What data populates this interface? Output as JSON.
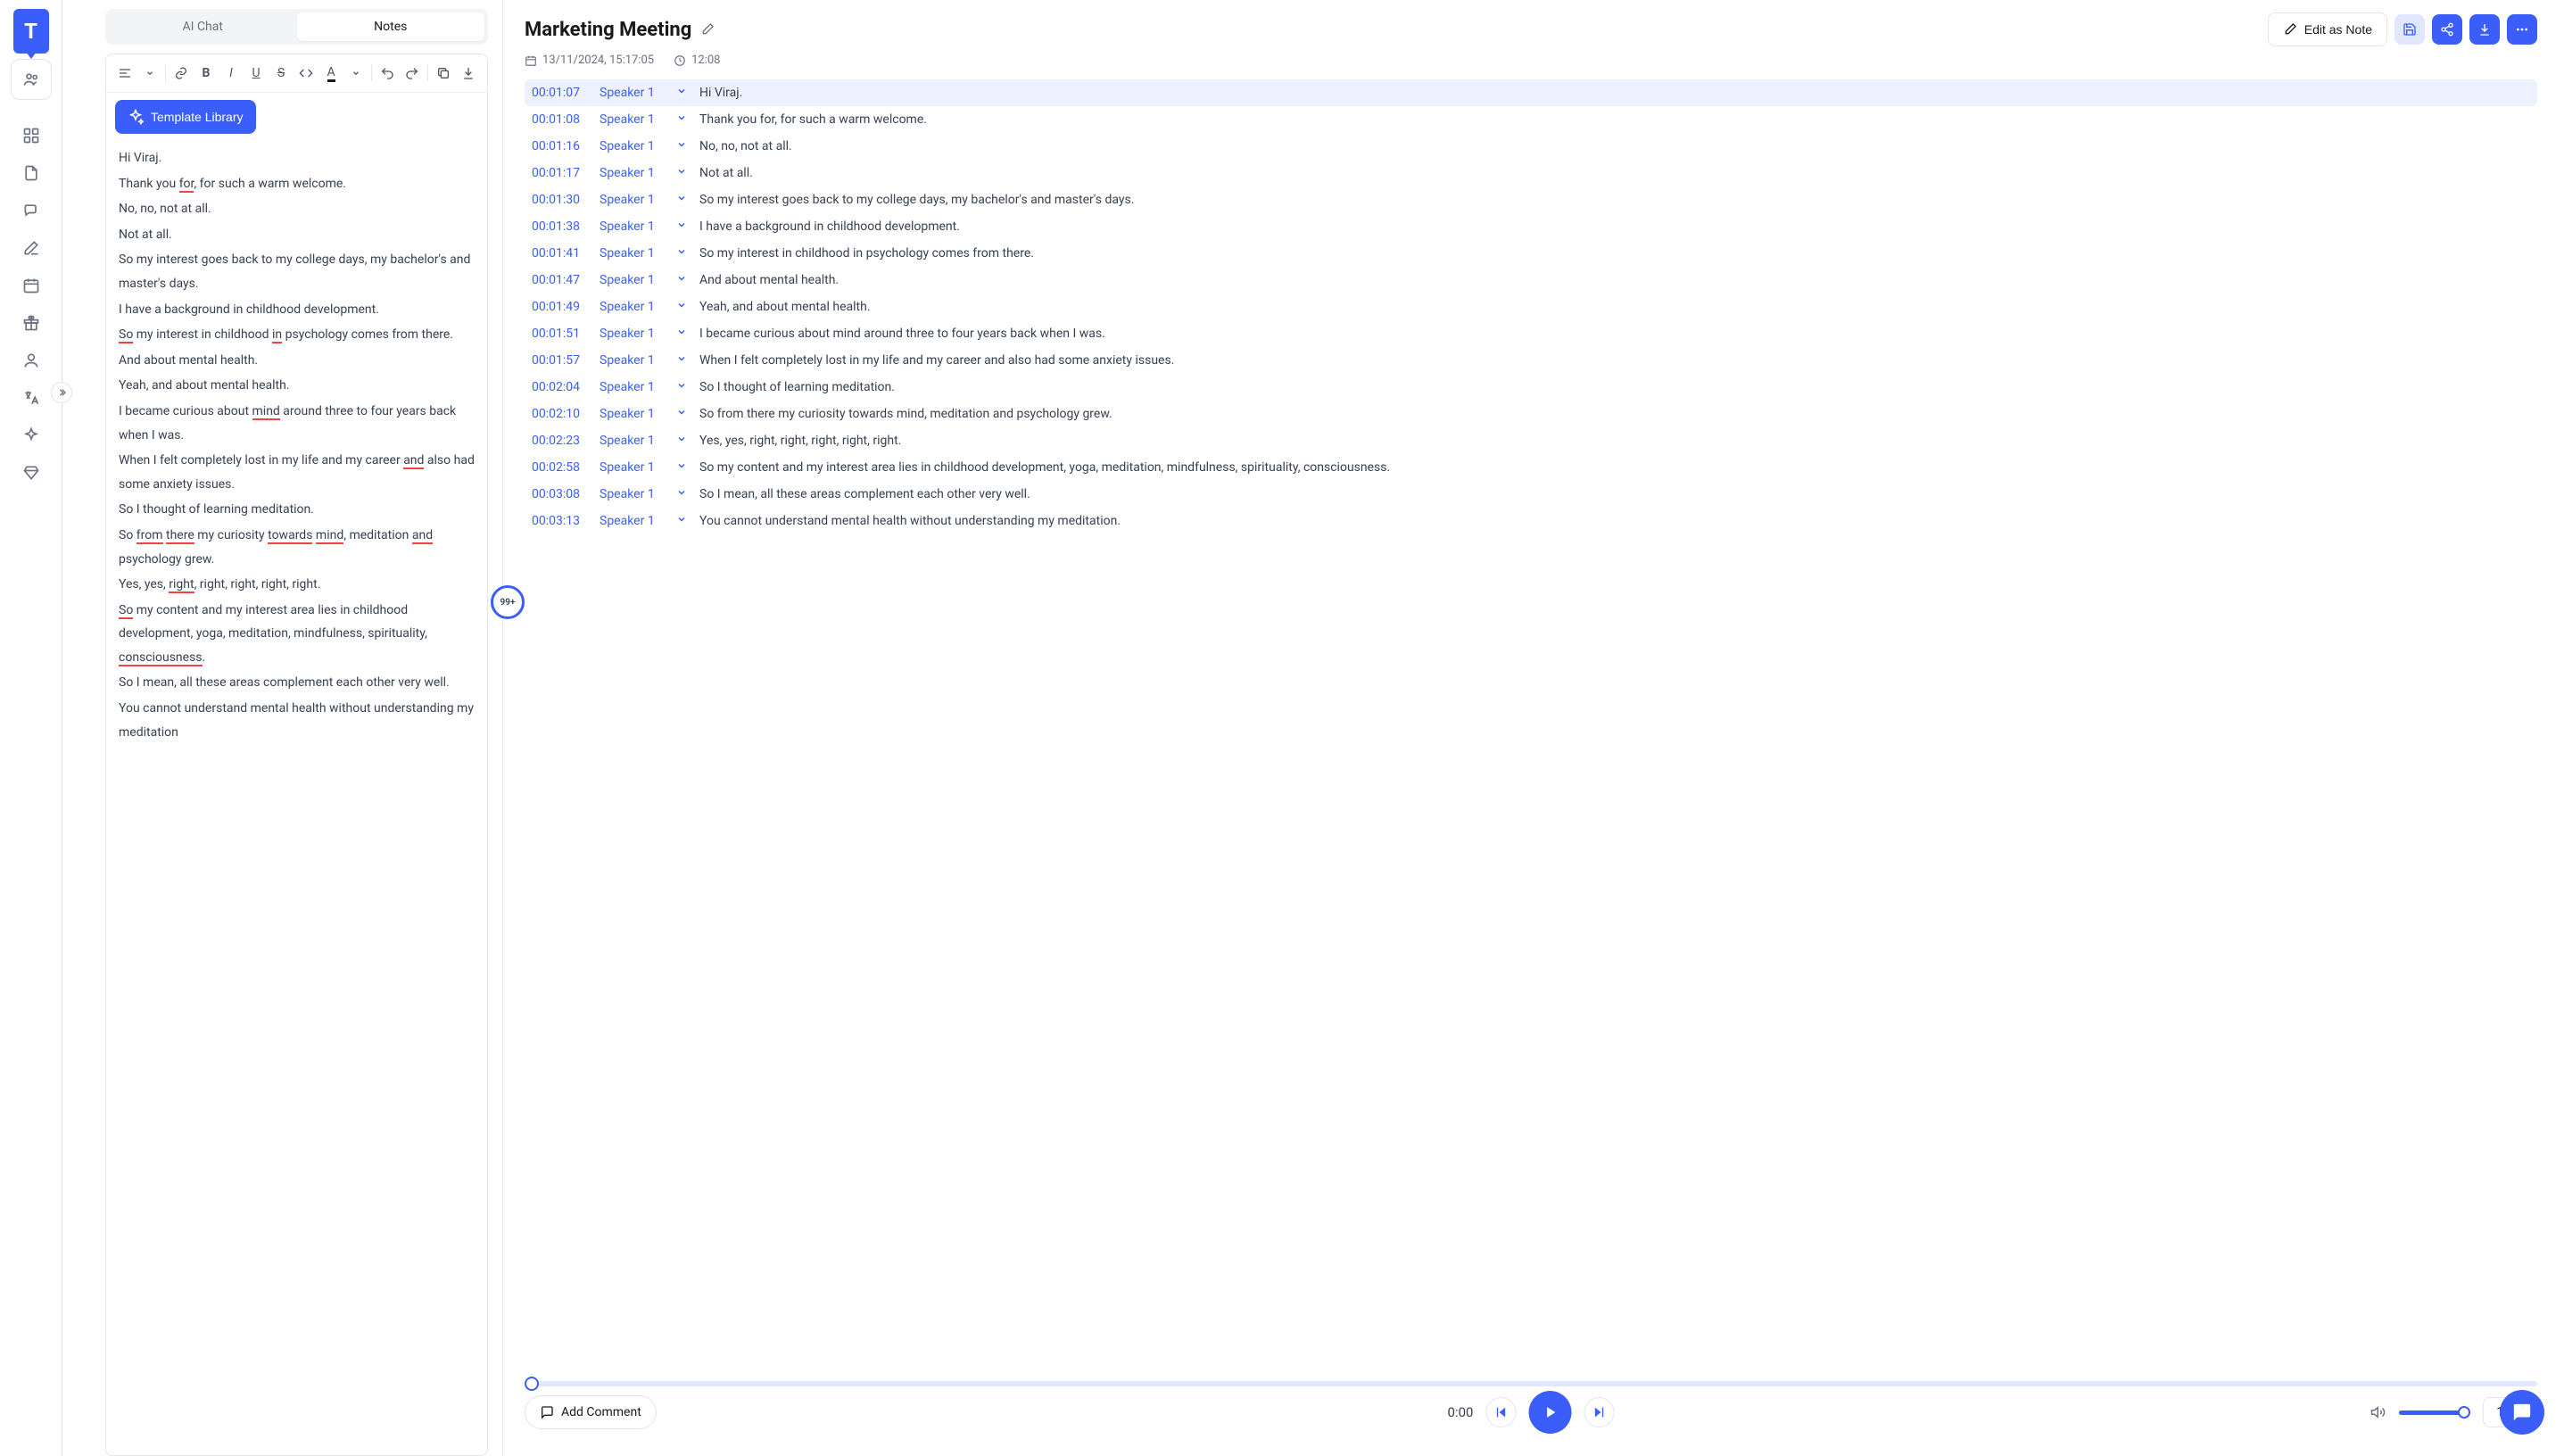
{
  "logo": "T",
  "tabs": {
    "chat": "AI Chat",
    "notes": "Notes"
  },
  "template_btn": "Template Library",
  "notes_lines": [
    "Hi Viraj.",
    "Thank you <u>for</u>, for such a warm welcome.",
    "No, no, not at all.",
    "Not at all.",
    "So my interest goes back to my college days, my bachelor's and master's days.",
    "I have a background in childhood development.",
    "<u>So</u> my interest in childhood <u>in</u> psychology comes from there.",
    "And about mental health.",
    "Yeah, and about mental health.",
    "I became curious about <u>mind</u> around three to four years back when I was.",
    "When I felt completely lost in my life and my career <u>and</u> also had some anxiety issues.",
    "So I thought of learning meditation.",
    "So <u>from</u> <u>there</u> my curiosity <u>towards</u> <u>mind</u>, meditation <u>and</u> psychology grew.",
    "Yes, yes, <u>right</u>, right, right, right, right.",
    "<u>So</u> my content and my interest area lies in childhood development, yoga, meditation, mindfulness, spirituality, <u>consciousness</u>.",
    "So I mean, all these areas complement each other very well.",
    "You cannot understand mental health without understanding my meditation"
  ],
  "doc_title": "Marketing Meeting",
  "edit_note": "Edit as Note",
  "meta": {
    "date": "13/11/2024, 15:17:05",
    "duration": "12:08"
  },
  "transcript": [
    {
      "time": "00:01:07",
      "speaker": "Speaker 1",
      "text": "Hi Viraj."
    },
    {
      "time": "00:01:08",
      "speaker": "Speaker 1",
      "text": "Thank you for, for such a warm welcome."
    },
    {
      "time": "00:01:16",
      "speaker": "Speaker 1",
      "text": "No, no, not at all."
    },
    {
      "time": "00:01:17",
      "speaker": "Speaker 1",
      "text": "Not at all."
    },
    {
      "time": "00:01:30",
      "speaker": "Speaker 1",
      "text": "So my interest goes back to my college days, my bachelor's and master's days."
    },
    {
      "time": "00:01:38",
      "speaker": "Speaker 1",
      "text": "I have a background in childhood development."
    },
    {
      "time": "00:01:41",
      "speaker": "Speaker 1",
      "text": "So my interest in childhood in psychology comes from there."
    },
    {
      "time": "00:01:47",
      "speaker": "Speaker 1",
      "text": "And about mental health."
    },
    {
      "time": "00:01:49",
      "speaker": "Speaker 1",
      "text": "Yeah, and about mental health."
    },
    {
      "time": "00:01:51",
      "speaker": "Speaker 1",
      "text": "I became curious about mind around three to four years back when I was."
    },
    {
      "time": "00:01:57",
      "speaker": "Speaker 1",
      "text": "When I felt completely lost in my life and my career and also had some anxiety issues."
    },
    {
      "time": "00:02:04",
      "speaker": "Speaker 1",
      "text": "So I thought of learning meditation."
    },
    {
      "time": "00:02:10",
      "speaker": "Speaker 1",
      "text": "So from there my curiosity towards mind, meditation and psychology grew."
    },
    {
      "time": "00:02:23",
      "speaker": "Speaker 1",
      "text": "Yes, yes, right, right, right, right, right."
    },
    {
      "time": "00:02:58",
      "speaker": "Speaker 1",
      "text": "So my content and my interest area lies in childhood development, yoga, meditation, mindfulness, spirituality, consciousness."
    },
    {
      "time": "00:03:08",
      "speaker": "Speaker 1",
      "text": "So I mean, all these areas complement each other very well."
    },
    {
      "time": "00:03:13",
      "speaker": "Speaker 1",
      "text": "You cannot understand mental health without understanding my meditation."
    }
  ],
  "add_comment": "Add Comment",
  "player": {
    "current": "0:00",
    "speed": "1x"
  },
  "badge": "99+"
}
